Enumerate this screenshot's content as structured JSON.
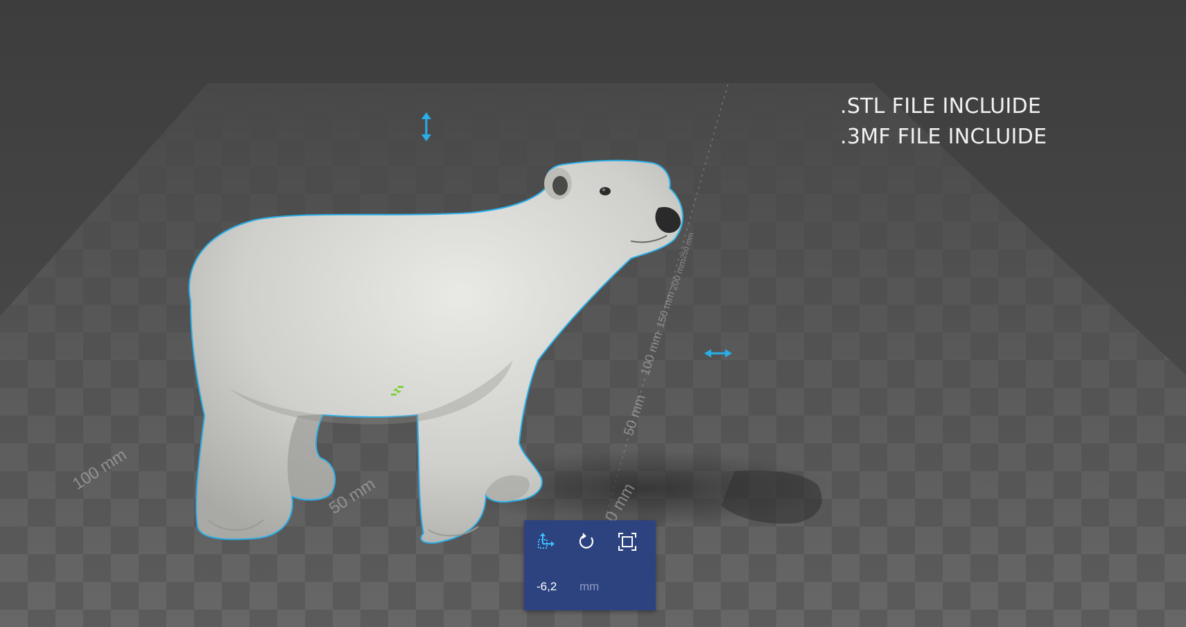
{
  "info_lines": [
    ".STL FILE INCLUIDE",
    ".3MF FILE INCLUIDE"
  ],
  "rulers": {
    "front": [
      "100 mm",
      "50 mm",
      "0 mm"
    ],
    "side": [
      "50 mm",
      "100 mm",
      "150 mm",
      "200 mm",
      "250 mm"
    ]
  },
  "gizmo": {
    "tools": [
      {
        "name": "move-tool",
        "icon": "move-icon"
      },
      {
        "name": "rotate-tool",
        "icon": "rotate-icon"
      },
      {
        "name": "scale-tool",
        "icon": "scale-icon"
      }
    ],
    "value": "-6,2",
    "unit": "mm"
  },
  "colors": {
    "selection_outline": "#29aee8",
    "gizmo_panel": "#2d4380",
    "gizmo_icon": "#3ec0ff",
    "center_handle": "#7fd13b"
  }
}
